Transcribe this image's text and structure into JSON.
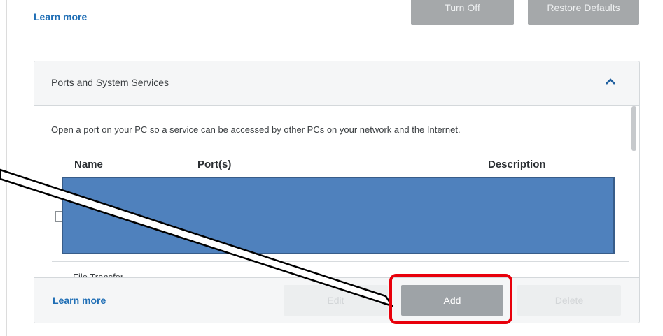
{
  "top": {
    "learn_more": "Learn more",
    "turn_off_label": "Turn Off",
    "restore_defaults_label": "Restore Defaults"
  },
  "panel": {
    "title": "Ports and System Services",
    "description": "Open a port on your PC so a service can be accessed by other PCs on your network and the Internet.",
    "columns": [
      "Name",
      "Port(s)",
      "Description"
    ],
    "partial_row_text": "File Transfer"
  },
  "footer": {
    "learn_more": "Learn more",
    "edit_label": "Edit",
    "add_label": "Add",
    "delete_label": "Delete"
  },
  "icons": {
    "collapse": "chevron-up-icon"
  },
  "colors": {
    "link": "#1f6eb5",
    "redaction": "#4f81bd",
    "highlight": "#e8000b"
  }
}
